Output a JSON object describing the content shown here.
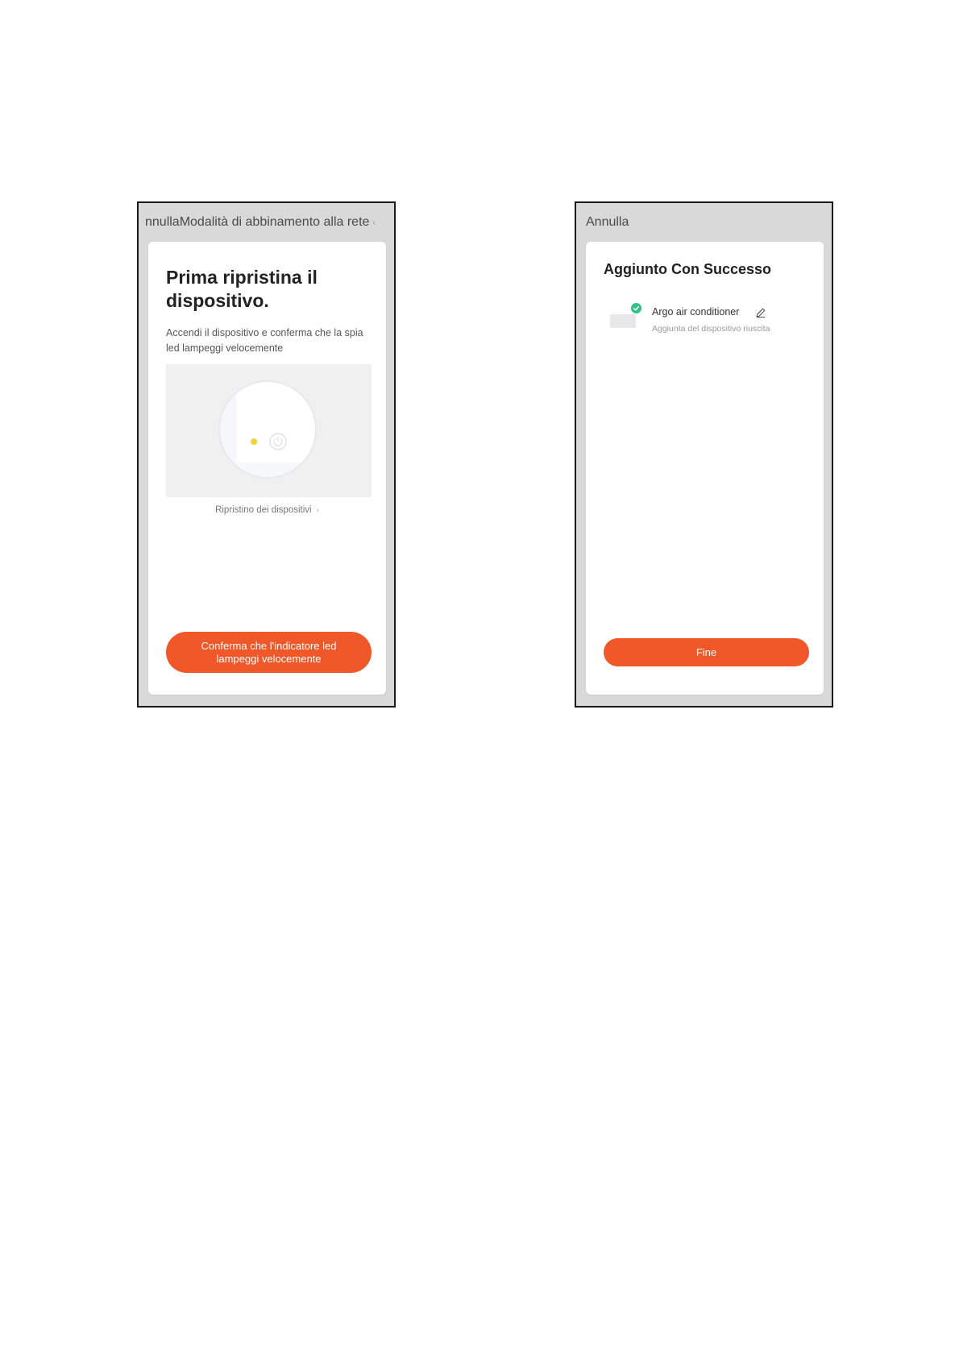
{
  "left_screen": {
    "topbar_title": "nnullaModalità di abbinamento alla rete",
    "title": "Prima ripristina il dispositivo.",
    "description": "Accendi il dispositivo e conferma che la spia led lampeggi velocemente",
    "reset_link": "Ripristino dei dispositivi",
    "confirm_button": "Conferma che l'indicatore led lampeggi velocemente",
    "icons": [
      "power-icon",
      "chevron-right-icon"
    ]
  },
  "right_screen": {
    "cancel_label": "Annulla",
    "title": "Aggiunto Con Successo",
    "device_name": "Argo air conditioner",
    "device_status": "Aggiunta del dispositivo riuscita",
    "done_button": "Fine",
    "icons": [
      "device-icon",
      "check-icon",
      "edit-pencil-icon"
    ]
  },
  "colors": {
    "accent": "#f0582a",
    "success": "#35c28a",
    "led": "#f3d23a",
    "frame_bg": "#d9d9d9"
  }
}
